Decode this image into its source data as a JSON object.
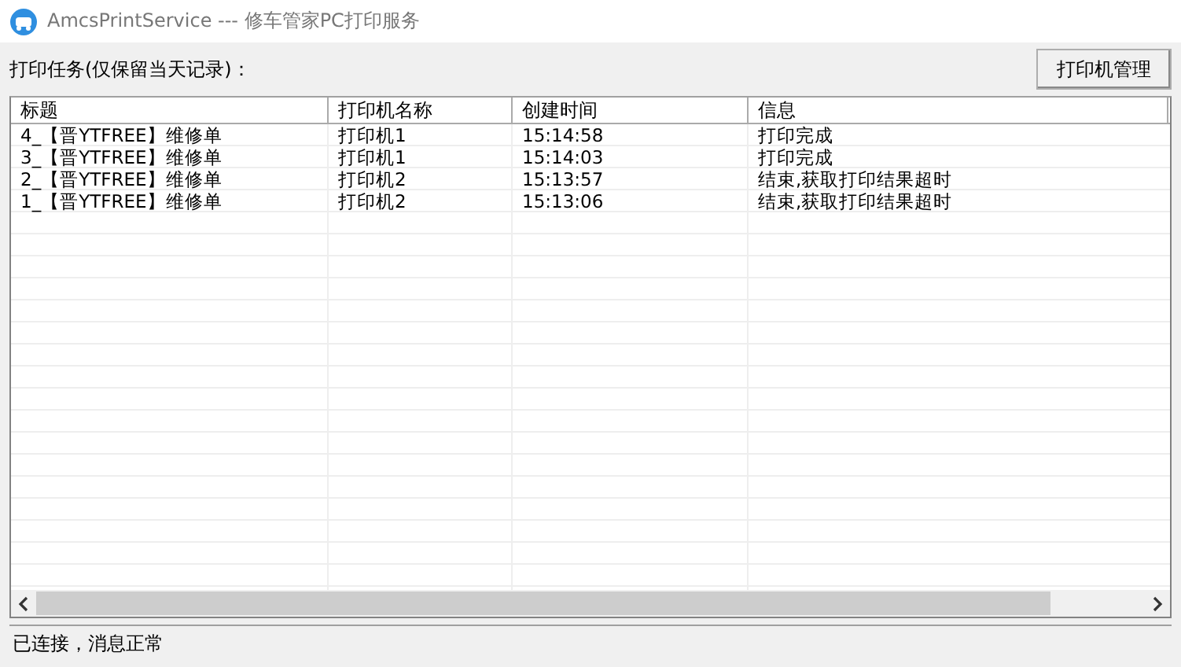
{
  "window": {
    "title": "AmcsPrintService --- 修车管家PC打印服务"
  },
  "task_label": "打印任务(仅保留当天记录)：",
  "manage_button": "打印机管理",
  "table": {
    "columns": [
      "标题",
      "打印机名称",
      "创建时间",
      "信息"
    ],
    "rows": [
      [
        "4_【晋YTFREE】维修单",
        "打印机1",
        "15:14:58",
        "打印完成"
      ],
      [
        "3_【晋YTFREE】维修单",
        "打印机1",
        "15:14:03",
        "打印完成"
      ],
      [
        "2_【晋YTFREE】维修单",
        "打印机2",
        "15:13:57",
        "结束,获取打印结果超时"
      ],
      [
        "1_【晋YTFREE】维修单",
        "打印机2",
        "15:13:06",
        "结束,获取打印结果超时"
      ]
    ]
  },
  "status_bar": "已连接，消息正常"
}
